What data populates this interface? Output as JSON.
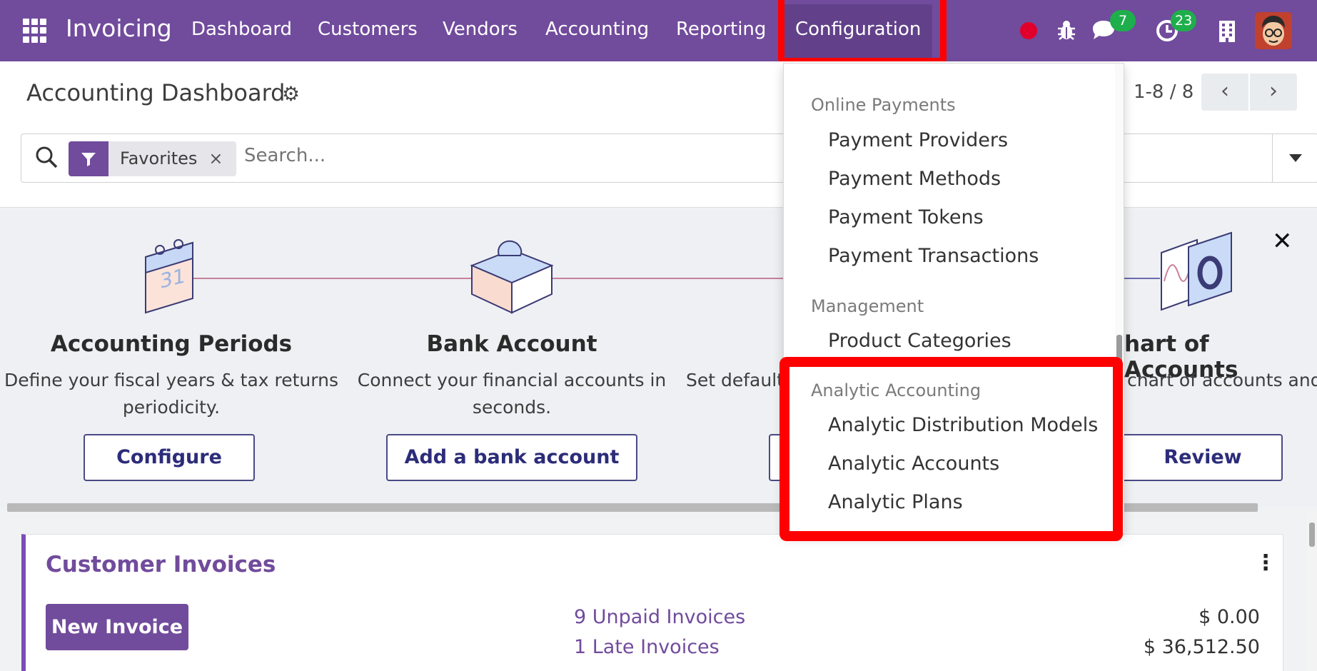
{
  "navbar": {
    "brand": "Invoicing",
    "menu": [
      "Dashboard",
      "Customers",
      "Vendors",
      "Accounting",
      "Reporting",
      "Configuration"
    ],
    "active_menu": "Configuration",
    "messages_count": "7",
    "activities_count": "23",
    "colors": {
      "bar": "#714b9c",
      "active": "#62418a",
      "badge": "#1fae4c",
      "highlight": "#ff0000"
    }
  },
  "control": {
    "title": "Accounting Dashboard",
    "pager": "1-8 / 8",
    "prev": "‹",
    "next": "›",
    "facet_label": "Favorites",
    "facet_remove": "×",
    "search_placeholder": "Search..."
  },
  "onboarding": {
    "close": "✕",
    "steps": [
      {
        "title": "Accounting Periods",
        "desc": "Define your fiscal years & tax returns periodicity.",
        "button": "Configure"
      },
      {
        "title": "Bank Account",
        "desc": "Connect your financial accounts in seconds.",
        "button": "Add a bank account"
      },
      {
        "title": "",
        "desc": "Set default",
        "button": ""
      },
      {
        "title": "hart of Accounts",
        "desc": "chart of accounts and r initial balances.",
        "button": "Review"
      }
    ]
  },
  "card": {
    "title": "Customer Invoices",
    "new_button": "New Invoice",
    "rows": [
      {
        "label": "9 Unpaid Invoices",
        "amount": "$ 0.00"
      },
      {
        "label": "1 Late Invoices",
        "amount": "$ 36,512.50"
      }
    ]
  },
  "dropdown": {
    "sections": [
      {
        "title": "Online Payments",
        "items": [
          "Payment Providers",
          "Payment Methods",
          "Payment Tokens",
          "Payment Transactions"
        ]
      },
      {
        "title": "Management",
        "items": [
          "Product Categories"
        ]
      },
      {
        "title": "Analytic Accounting",
        "items": [
          "Analytic Distribution Models",
          "Analytic Accounts",
          "Analytic Plans"
        ]
      }
    ]
  }
}
